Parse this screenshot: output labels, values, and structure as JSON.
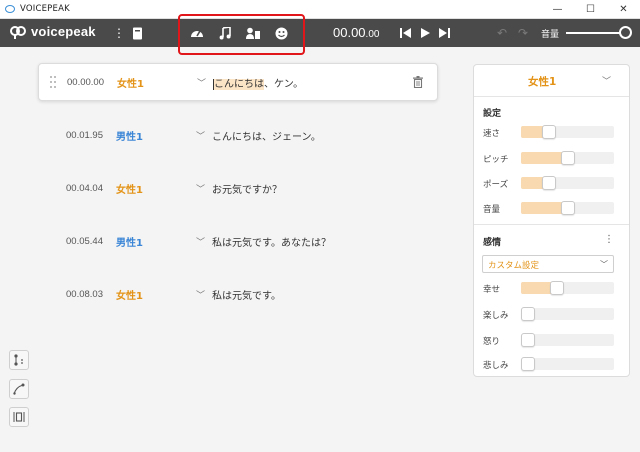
{
  "window": {
    "title": "VOICEPEAK",
    "minimize": "—",
    "maximize": "☐",
    "close": "✕"
  },
  "toolbar": {
    "brand": "voicepeak",
    "menu_icon": "⋮",
    "time_main": "00.00",
    "time_frac": ".00",
    "volume_label": "音量",
    "volume_value": 0.88
  },
  "rows": [
    {
      "time": "00.00.00",
      "speaker": "女性1",
      "speaker_color": "#e39317",
      "text_highlight": "こんにちは",
      "text_rest": "、ケン。",
      "active": true
    },
    {
      "time": "00.01.95",
      "speaker": "男性1",
      "speaker_color": "#3b86d6",
      "text": "こんにちは、ジェーン。"
    },
    {
      "time": "00.04.04",
      "speaker": "女性1",
      "speaker_color": "#e39317",
      "text": "お元気ですか？"
    },
    {
      "time": "00.05.44",
      "speaker": "男性1",
      "speaker_color": "#3b86d6",
      "text": "私は元気です。あなたは？"
    },
    {
      "time": "00.08.03",
      "speaker": "女性1",
      "speaker_color": "#e39317",
      "text": "私は元気です。"
    }
  ],
  "panel": {
    "speaker": "女性1",
    "settings_title": "設定",
    "settings": [
      {
        "label": "速さ",
        "value": 0.27
      },
      {
        "label": "ピッチ",
        "value": 0.5
      },
      {
        "label": "ポーズ",
        "value": 0.27
      },
      {
        "label": "音量",
        "value": 0.5
      }
    ],
    "emotion_title": "感情",
    "emotion_preset": "カスタム設定",
    "emotions": [
      {
        "label": "幸せ",
        "value": 0.37
      },
      {
        "label": "楽しみ",
        "value": 0.0
      },
      {
        "label": "怒り",
        "value": 0.0
      },
      {
        "label": "悲しみ",
        "value": 0.0
      }
    ]
  },
  "colors": {
    "accent": "#e39317",
    "male": "#3b86d6",
    "toolbar_bg": "#4a4a4a",
    "highlight_box": "#e0161b"
  }
}
